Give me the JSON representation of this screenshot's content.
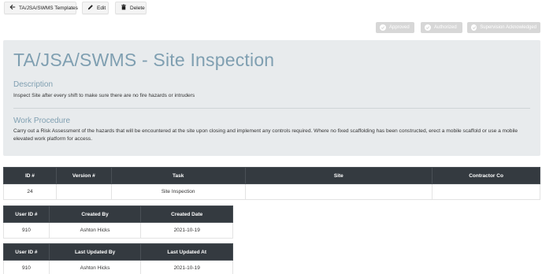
{
  "toolbar": {
    "back_label": "TA/JSA/SWMS Templates",
    "edit_label": "Edit",
    "delete_label": "Delete"
  },
  "status": {
    "approved": "Approved",
    "authorized": "Authorized",
    "supervision": "Supervision Acknowledged"
  },
  "panel": {
    "title": "TA/JSA/SWMS - Site Inspection",
    "description_heading": "Description",
    "description_text": "Inspect Site after every shift to make sure there are no fire hazards or intruders",
    "procedure_heading": "Work Procedure",
    "procedure_text": "Carry out a Risk Assessment of the hazards that will be encountered at the site upon closing and implement any controls required. Where no fixed scaffolding has been constructed, erect a mobile scaffold or use a mobile elevated work platform for access."
  },
  "main_table": {
    "headers": [
      "ID #",
      "Version #",
      "Task",
      "Site",
      "Contractor Co"
    ],
    "row": [
      "24",
      "",
      "Site Inspection",
      "",
      ""
    ]
  },
  "created_table": {
    "headers": [
      "User ID #",
      "Created By",
      "Created Date"
    ],
    "row": [
      "910",
      "Ashton Hicks",
      "2021-10-19"
    ]
  },
  "updated_table": {
    "headers": [
      "User ID #",
      "Last Updated By",
      "Last Updated At"
    ],
    "row": [
      "910",
      "Ashton Hicks",
      "2021-10-19"
    ]
  },
  "icons": {
    "back": "arrow-left-icon",
    "edit": "pencil-icon",
    "delete": "trash-icon",
    "status": "check-circle-icon"
  },
  "colors": {
    "heading": "#7f9fb1",
    "panel_bg": "#e8ebed",
    "table_header": "#343a40",
    "status_disabled": "#d7d7d7"
  }
}
